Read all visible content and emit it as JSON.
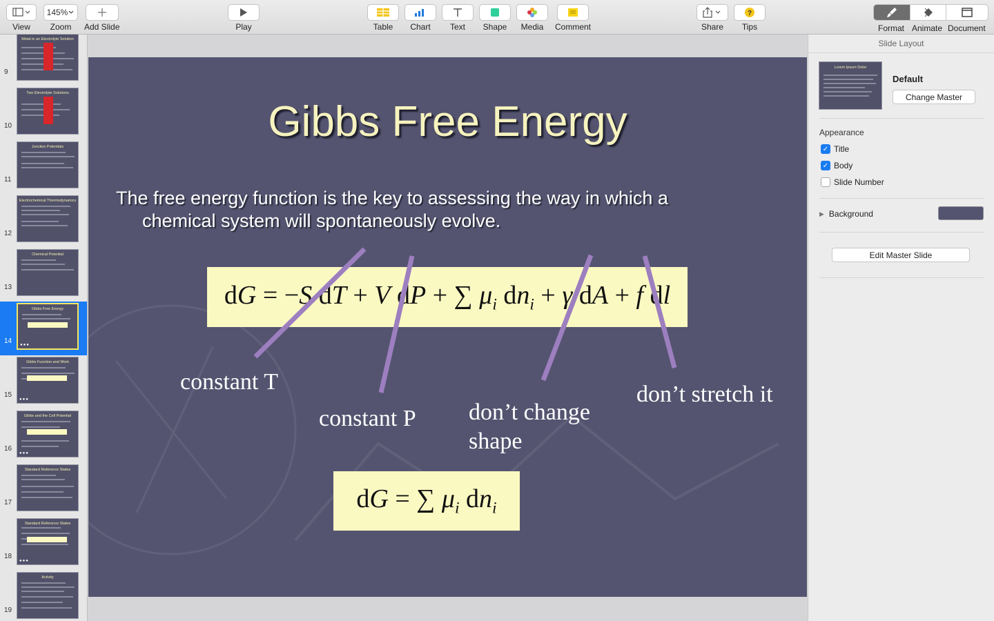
{
  "toolbar": {
    "view": {
      "label": "View",
      "icon": "sidebar-icon"
    },
    "zoom": {
      "label": "Zoom",
      "value": "145%"
    },
    "add_slide": {
      "label": "Add Slide",
      "icon": "plus-icon"
    },
    "play": {
      "label": "Play",
      "icon": "play-icon"
    },
    "table": {
      "label": "Table",
      "icon": "table-icon"
    },
    "chart": {
      "label": "Chart",
      "icon": "bar-chart-icon"
    },
    "text": {
      "label": "Text",
      "icon": "text-t-icon"
    },
    "shape": {
      "label": "Shape",
      "icon": "square-icon"
    },
    "media": {
      "label": "Media",
      "icon": "photos-icon"
    },
    "comment": {
      "label": "Comment",
      "icon": "comment-icon"
    },
    "share": {
      "label": "Share",
      "icon": "share-icon"
    },
    "tips": {
      "label": "Tips",
      "icon": "question-icon"
    },
    "format": {
      "label": "Format",
      "icon": "paintbrush-icon"
    },
    "animate": {
      "label": "Animate",
      "icon": "diamond-icon"
    },
    "document": {
      "label": "Document",
      "icon": "document-icon"
    }
  },
  "navigator": {
    "selected_slide": 14,
    "slides": [
      {
        "number": "9",
        "title": "Metal in an Electrolyte Solution"
      },
      {
        "number": "10",
        "title": "Two Electrolyte Solutions"
      },
      {
        "number": "11",
        "title": "Junction Potentials"
      },
      {
        "number": "12",
        "title": "Electrochemical Thermodynamics"
      },
      {
        "number": "13",
        "title": "Chemical Potential"
      },
      {
        "number": "14",
        "title": "Gibbs Free Energy"
      },
      {
        "number": "15",
        "title": "Gibbs Function and Work"
      },
      {
        "number": "16",
        "title": "Gibbs and the Cell Potential"
      },
      {
        "number": "17",
        "title": "Standard Reference States"
      },
      {
        "number": "18",
        "title": "Standard Reference States"
      },
      {
        "number": "19",
        "title": "Activity"
      }
    ]
  },
  "slide": {
    "title": "Gibbs Free Energy",
    "body": "The free energy function is the key to assessing the way in which a chemical system will spontaneously evolve.",
    "equation_main": "dG = −S dT + V dP + ∑ μi dni + γ dA + f dl",
    "equation_simple": "dG = ∑ μi dni",
    "callouts": {
      "constant_t": "constant T",
      "constant_p": "constant P",
      "dont_change_shape": "don’t change shape",
      "dont_stretch": "don’t stretch it"
    },
    "colors": {
      "background": "#545470",
      "title": "#f7f3bf",
      "equation_box": "#fbf9c2",
      "strike": "#9d7fc0"
    }
  },
  "inspector": {
    "header": "Slide Layout",
    "layout_name": "Default",
    "change_master_label": "Change Master",
    "layout_thumb_title": "Lorem Ipsum Dolor",
    "appearance_label": "Appearance",
    "title_check": {
      "label": "Title",
      "checked": true
    },
    "body_check": {
      "label": "Body",
      "checked": true
    },
    "slide_number_check": {
      "label": "Slide Number",
      "checked": false
    },
    "background_label": "Background",
    "edit_master_label": "Edit Master Slide"
  }
}
